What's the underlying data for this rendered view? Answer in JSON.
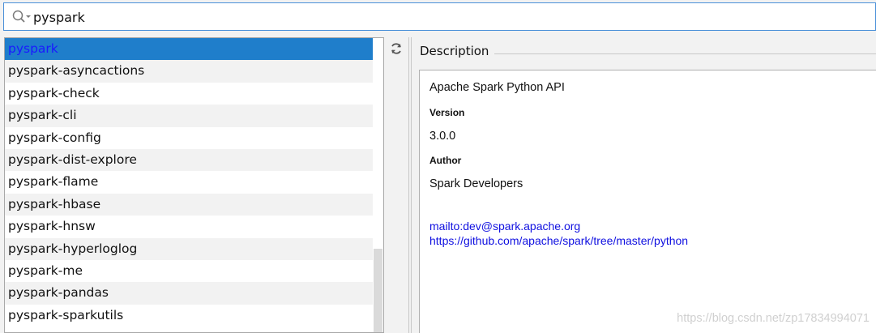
{
  "search": {
    "value": "pyspark",
    "icon": "search-icon"
  },
  "packages": [
    {
      "name": "pyspark",
      "selected": true
    },
    {
      "name": "pyspark-asyncactions"
    },
    {
      "name": "pyspark-check"
    },
    {
      "name": "pyspark-cli"
    },
    {
      "name": "pyspark-config"
    },
    {
      "name": "pyspark-dist-explore"
    },
    {
      "name": "pyspark-flame"
    },
    {
      "name": "pyspark-hbase"
    },
    {
      "name": "pyspark-hnsw"
    },
    {
      "name": "pyspark-hyperloglog"
    },
    {
      "name": "pyspark-me"
    },
    {
      "name": "pyspark-pandas"
    },
    {
      "name": "pyspark-sparkutils"
    }
  ],
  "toolbar": {
    "refresh_icon": "refresh-icon"
  },
  "description": {
    "header": "Description",
    "summary": "Apache Spark Python API",
    "version_label": "Version",
    "version": "3.0.0",
    "author_label": "Author",
    "author": "Spark Developers",
    "email_link": "mailto:dev@spark.apache.org",
    "homepage_link": "https://github.com/apache/spark/tree/master/python"
  },
  "watermark": "https://blog.csdn.net/zp17834994071",
  "colors": {
    "selection": "#1f7ecb",
    "link": "#1010e0",
    "focus_border": "#4a90d9"
  }
}
